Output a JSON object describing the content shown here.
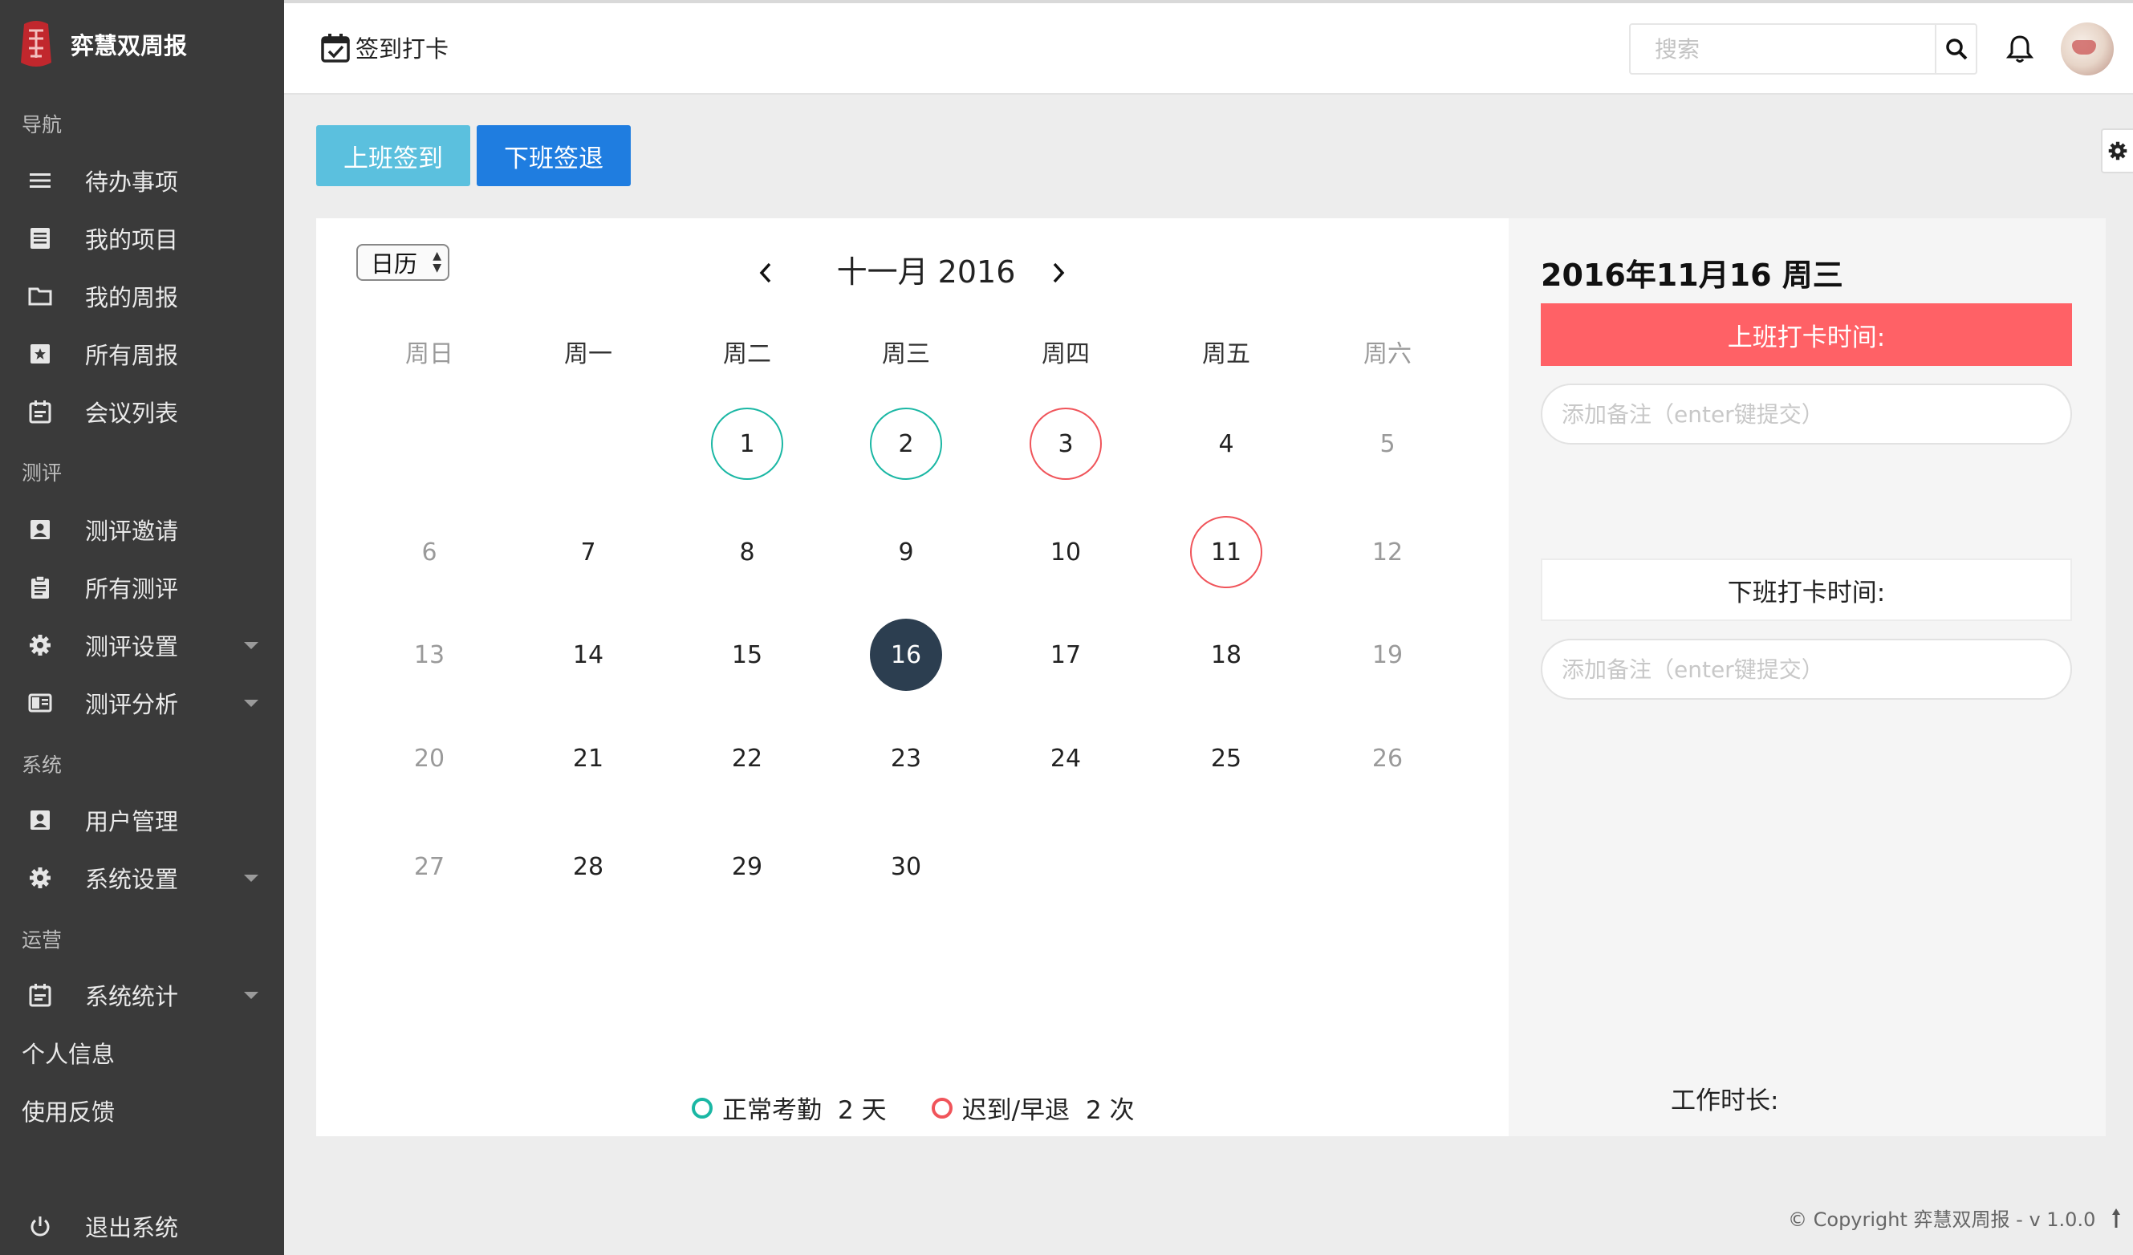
{
  "brand": {
    "name": "弈慧双周报"
  },
  "sidebar": {
    "sections": {
      "nav": "导航",
      "review": "测评",
      "system": "系统",
      "ops": "运营"
    },
    "items": [
      {
        "label": "待办事项",
        "icon": "menu-icon"
      },
      {
        "label": "我的项目",
        "icon": "list-icon"
      },
      {
        "label": "我的周报",
        "icon": "folder-icon"
      },
      {
        "label": "所有周报",
        "icon": "star-box-icon"
      },
      {
        "label": "会议列表",
        "icon": "calendar-icon"
      },
      {
        "label": "测评邀请",
        "icon": "contact-icon"
      },
      {
        "label": "所有测评",
        "icon": "clipboard-icon"
      },
      {
        "label": "测评设置",
        "icon": "gear-icon"
      },
      {
        "label": "测评分析",
        "icon": "chart-icon"
      },
      {
        "label": "用户管理",
        "icon": "contact-icon"
      },
      {
        "label": "系统设置",
        "icon": "gear-icon"
      },
      {
        "label": "系统统计",
        "icon": "calendar-icon"
      },
      {
        "label": "个人信息"
      },
      {
        "label": "使用反馈"
      }
    ],
    "logout": "退出系统"
  },
  "header": {
    "title": "签到打卡",
    "search_placeholder": "搜索"
  },
  "actions": {
    "checkin": "上班签到",
    "checkout": "下班签退"
  },
  "calendar": {
    "view": "日历",
    "month_title": "十一月 2016",
    "weekdays": [
      "周日",
      "周一",
      "周二",
      "周三",
      "周四",
      "周五",
      "周六"
    ],
    "weeks": [
      [
        "",
        "",
        "1",
        "2",
        "3",
        "4",
        "5"
      ],
      [
        "6",
        "7",
        "8",
        "9",
        "10",
        "11",
        "12"
      ],
      [
        "13",
        "14",
        "15",
        "16",
        "17",
        "18",
        "19"
      ],
      [
        "20",
        "21",
        "22",
        "23",
        "24",
        "25",
        "26"
      ],
      [
        "27",
        "28",
        "29",
        "30",
        "",
        "",
        ""
      ]
    ],
    "normal_days": [
      "1",
      "2"
    ],
    "late_days": [
      "3",
      "11"
    ],
    "today": "16",
    "legend": {
      "normal_label": "正常考勤",
      "normal_count": "2 天",
      "late_label": "迟到/早退",
      "late_count": "2 次"
    },
    "colors": {
      "normal": "#1ab7a4",
      "late": "#f0545a",
      "today": "#2c3e50"
    }
  },
  "detail": {
    "date": "2016年11月16 周三",
    "checkin_label": "上班打卡时间:",
    "checkout_label": "下班打卡时间:",
    "note_placeholder": "添加备注（enter键提交）",
    "work_hours_label": "工作时长:"
  },
  "footer": {
    "copyright": "© Copyright 弈慧双周报 - v 1.0.0"
  }
}
